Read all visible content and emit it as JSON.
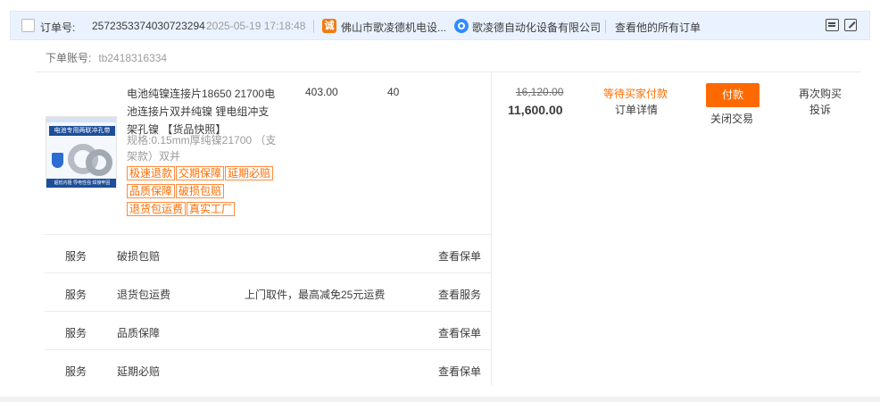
{
  "header": {
    "order_label": "订单号:",
    "order_no": "2572353374030723294",
    "time": "2025-05-19 17:18:48",
    "shop_name": "佛山市歌凌德机电设...",
    "shop_icon_text": "诚",
    "wangwang_name": "歌凌德自动化设备有限公司",
    "all_orders_link": "查看他的所有订单"
  },
  "account": {
    "label": "下单账号:",
    "value": "tb2418316334"
  },
  "product": {
    "title": "电池纯镍连接片18650 21700电池连接片双并纯镍 锂电组冲支架孔镍 【货品快照】",
    "sku": "规格:0.15mm厚纯镍21700 （支架款）双并",
    "image_top_text": "电池专用两联冲孔带",
    "image_bottom_text": "超低内阻 导电性强 焊接牢固",
    "tags": [
      "极速退款",
      "交期保障",
      "延期必赔",
      "品质保障",
      "破损包赔",
      "退货包运费",
      "真实工厂"
    ],
    "unit_price": "403.00",
    "quantity": "40"
  },
  "totals": {
    "original": "16,120.00",
    "amount": "11,600.00"
  },
  "status": {
    "text": "等待买家付款",
    "detail_link": "订单详情"
  },
  "actions": {
    "pay": "付款",
    "close": "关闭交易",
    "rebuy": "再次购买",
    "complain": "投诉"
  },
  "services": [
    {
      "label": "服务",
      "name": "破损包赔",
      "desc": "",
      "link": "查看保单"
    },
    {
      "label": "服务",
      "name": "退货包运费",
      "desc": "上门取件，最高减免25元运费",
      "link": "查看服务"
    },
    {
      "label": "服务",
      "name": "品质保障",
      "desc": "",
      "link": "查看保单"
    },
    {
      "label": "服务",
      "name": "延期必赔",
      "desc": "",
      "link": "查看保单"
    }
  ],
  "colors": {
    "accent": "#ff6a00",
    "status": "#ff6d00",
    "header_bg": "#eaf2ff"
  }
}
